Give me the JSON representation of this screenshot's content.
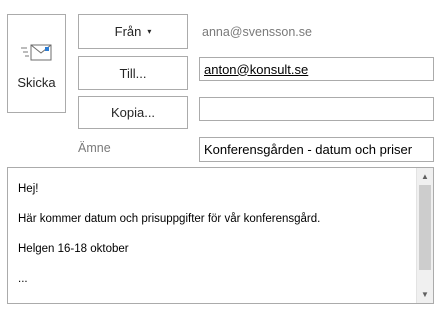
{
  "send": {
    "label": "Skicka",
    "icon": "send-envelope-icon"
  },
  "from": {
    "button_label": "Från",
    "caret": "▾",
    "value": "anna@svensson.se"
  },
  "to": {
    "button_label": "Till...",
    "value": "anton@konsult.se"
  },
  "cc": {
    "button_label": "Kopia...",
    "value": ""
  },
  "subject": {
    "label": "Ämne",
    "value": "Konferensgården - datum och priser"
  },
  "body": {
    "lines": [
      "Hej!",
      "Här kommer datum och prisuppgifter för vår konferensgård.",
      "Helgen 16-18 oktober",
      "..."
    ]
  },
  "scrollbar": {
    "up": "▲",
    "down": "▼"
  }
}
